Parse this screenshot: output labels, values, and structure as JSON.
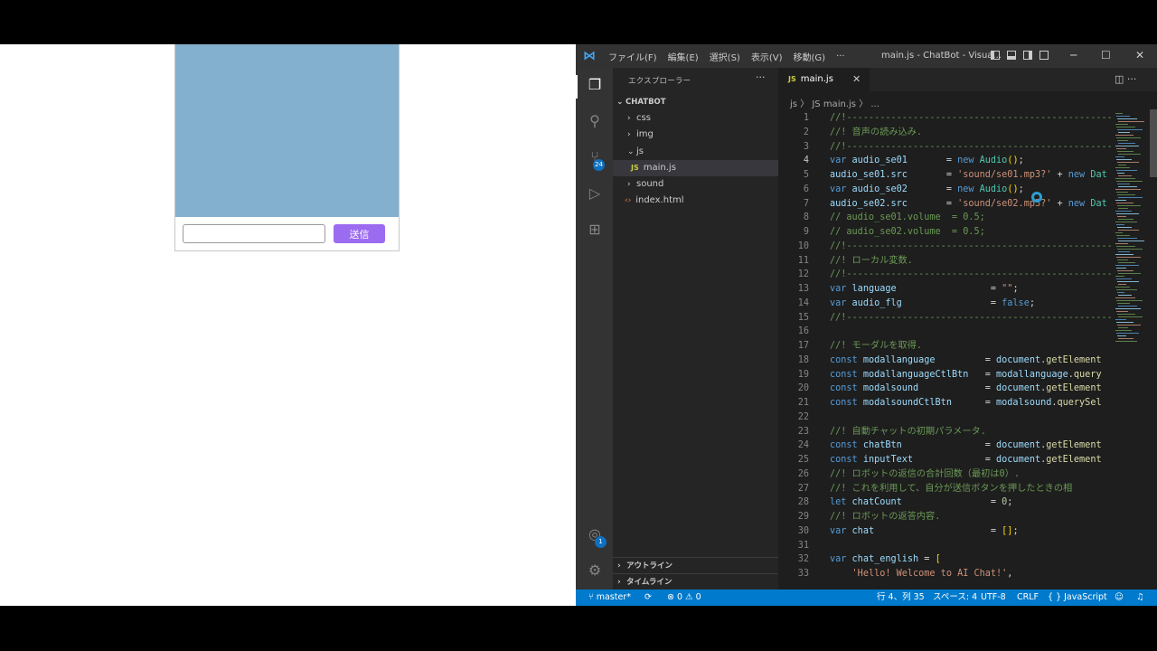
{
  "preview": {
    "chat_input_value": "",
    "send_label": "送信",
    "accent": "#9b6bf0",
    "chat_bg": "#84b0cf"
  },
  "titlebar": {
    "menus": [
      "ファイル(F)",
      "編集(E)",
      "選択(S)",
      "表示(V)",
      "移動(G)",
      "···"
    ],
    "title": "main.js - ChatBot - Visua..."
  },
  "activity": {
    "scm_badge": "24",
    "accounts_badge": "1"
  },
  "sidebar": {
    "title": "エクスプローラー",
    "more": "···",
    "root": "CHATBOT",
    "items": [
      {
        "label": "css",
        "type": "folder",
        "expanded": false
      },
      {
        "label": "img",
        "type": "folder",
        "expanded": false
      },
      {
        "label": "js",
        "type": "folder",
        "expanded": true
      },
      {
        "label": "main.js",
        "type": "js",
        "selected": true
      },
      {
        "label": "sound",
        "type": "folder",
        "expanded": false
      },
      {
        "label": "index.html",
        "type": "html"
      }
    ],
    "outline": "アウトライン",
    "timeline": "タイムライン"
  },
  "editor": {
    "tab_label": "main.js",
    "breadcrumb": "js 〉 JS main.js 〉 ...",
    "lines": [
      {
        "n": "1",
        "t": [
          [
            "com",
            "//!-----------------------------------------------------------"
          ]
        ]
      },
      {
        "n": "2",
        "t": [
          [
            "com",
            "//! 音声の読み込み."
          ]
        ]
      },
      {
        "n": "3",
        "t": [
          [
            "com",
            "//!-----------------------------------------------------------"
          ]
        ]
      },
      {
        "n": "4",
        "t": [
          [
            "kw",
            "var "
          ],
          [
            "var",
            "audio_se01"
          ],
          [
            "pun",
            "       = "
          ],
          [
            "kw",
            "new "
          ],
          [
            "cls",
            "Audio"
          ],
          [
            "br",
            "()"
          ],
          [
            "pun",
            ";"
          ]
        ]
      },
      {
        "n": "5",
        "t": [
          [
            "var",
            "audio_se01"
          ],
          [
            "pun",
            "."
          ],
          [
            "var",
            "src"
          ],
          [
            "pun",
            "       = "
          ],
          [
            "str",
            "'sound/se01.mp3?'"
          ],
          [
            "pun",
            " + "
          ],
          [
            "kw",
            "new "
          ],
          [
            "cls",
            "Dat"
          ]
        ]
      },
      {
        "n": "6",
        "t": [
          [
            "kw",
            "var "
          ],
          [
            "var",
            "audio_se02"
          ],
          [
            "pun",
            "       = "
          ],
          [
            "kw",
            "new "
          ],
          [
            "cls",
            "Audio"
          ],
          [
            "br",
            "()"
          ],
          [
            "pun",
            ";"
          ]
        ]
      },
      {
        "n": "7",
        "t": [
          [
            "var",
            "audio_se02"
          ],
          [
            "pun",
            "."
          ],
          [
            "var",
            "src"
          ],
          [
            "pun",
            "       = "
          ],
          [
            "str",
            "'sound/se02.mp3?'"
          ],
          [
            "pun",
            " + "
          ],
          [
            "kw",
            "new "
          ],
          [
            "cls",
            "Dat"
          ]
        ]
      },
      {
        "n": "8",
        "t": [
          [
            "com",
            "// audio_se01.volume  = 0.5;"
          ]
        ]
      },
      {
        "n": "9",
        "t": [
          [
            "com",
            "// audio_se02.volume  = 0.5;"
          ]
        ]
      },
      {
        "n": "10",
        "t": [
          [
            "com",
            "//!-----------------------------------------------------------"
          ]
        ]
      },
      {
        "n": "11",
        "t": [
          [
            "com",
            "//! ローカル変数."
          ]
        ]
      },
      {
        "n": "12",
        "t": [
          [
            "com",
            "//!-----------------------------------------------------------"
          ]
        ]
      },
      {
        "n": "13",
        "t": [
          [
            "kw",
            "var "
          ],
          [
            "var",
            "language"
          ],
          [
            "pun",
            "                 = "
          ],
          [
            "str",
            "\"\""
          ],
          [
            "pun",
            ";"
          ]
        ]
      },
      {
        "n": "14",
        "t": [
          [
            "kw",
            "var "
          ],
          [
            "var",
            "audio_flg"
          ],
          [
            "pun",
            "                = "
          ],
          [
            "kw",
            "false"
          ],
          [
            "pun",
            ";"
          ]
        ]
      },
      {
        "n": "15",
        "t": [
          [
            "com",
            "//!-----------------------------------------------------------"
          ]
        ]
      },
      {
        "n": "16",
        "t": []
      },
      {
        "n": "17",
        "t": [
          [
            "com",
            "//! モーダルを取得."
          ]
        ]
      },
      {
        "n": "18",
        "t": [
          [
            "kw",
            "const "
          ],
          [
            "var",
            "modallanguage"
          ],
          [
            "pun",
            "         = "
          ],
          [
            "var",
            "document"
          ],
          [
            "pun",
            "."
          ],
          [
            "fn",
            "getElement"
          ]
        ]
      },
      {
        "n": "19",
        "t": [
          [
            "kw",
            "const "
          ],
          [
            "var",
            "modallanguageCtlBtn"
          ],
          [
            "pun",
            "   = "
          ],
          [
            "var",
            "modallanguage"
          ],
          [
            "pun",
            "."
          ],
          [
            "fn",
            "query"
          ]
        ]
      },
      {
        "n": "20",
        "t": [
          [
            "kw",
            "const "
          ],
          [
            "var",
            "modalsound"
          ],
          [
            "pun",
            "            = "
          ],
          [
            "var",
            "document"
          ],
          [
            "pun",
            "."
          ],
          [
            "fn",
            "getElement"
          ]
        ]
      },
      {
        "n": "21",
        "t": [
          [
            "kw",
            "const "
          ],
          [
            "var",
            "modalsoundCtlBtn"
          ],
          [
            "pun",
            "      = "
          ],
          [
            "var",
            "modalsound"
          ],
          [
            "pun",
            "."
          ],
          [
            "fn",
            "querySel"
          ]
        ]
      },
      {
        "n": "22",
        "t": []
      },
      {
        "n": "23",
        "t": [
          [
            "com",
            "//! 自動チャットの初期パラメータ."
          ]
        ]
      },
      {
        "n": "24",
        "t": [
          [
            "kw",
            "const "
          ],
          [
            "var",
            "chatBtn"
          ],
          [
            "pun",
            "               = "
          ],
          [
            "var",
            "document"
          ],
          [
            "pun",
            "."
          ],
          [
            "fn",
            "getElement"
          ]
        ]
      },
      {
        "n": "25",
        "t": [
          [
            "kw",
            "const "
          ],
          [
            "var",
            "inputText"
          ],
          [
            "pun",
            "             = "
          ],
          [
            "var",
            "document"
          ],
          [
            "pun",
            "."
          ],
          [
            "fn",
            "getElement"
          ]
        ]
      },
      {
        "n": "26",
        "t": [
          [
            "com",
            "//! ロボットの返信の合計回数（最初は0）."
          ]
        ]
      },
      {
        "n": "27",
        "t": [
          [
            "com",
            "//! これを利用して、自分が送信ボタンを押したときの相"
          ]
        ]
      },
      {
        "n": "28",
        "t": [
          [
            "kw",
            "let "
          ],
          [
            "var",
            "chatCount"
          ],
          [
            "pun",
            "                = "
          ],
          [
            "num",
            "0"
          ],
          [
            "pun",
            ";"
          ]
        ]
      },
      {
        "n": "29",
        "t": [
          [
            "com",
            "//! ロボットの返答内容."
          ]
        ]
      },
      {
        "n": "30",
        "t": [
          [
            "kw",
            "var "
          ],
          [
            "var",
            "chat"
          ],
          [
            "pun",
            "                     = "
          ],
          [
            "br",
            "[]"
          ],
          [
            "pun",
            ";"
          ]
        ]
      },
      {
        "n": "31",
        "t": []
      },
      {
        "n": "32",
        "t": [
          [
            "kw",
            "var "
          ],
          [
            "var",
            "chat_english"
          ],
          [
            "pun",
            " = "
          ],
          [
            "br",
            "["
          ]
        ]
      },
      {
        "n": "33",
        "t": [
          [
            "pun",
            "    "
          ],
          [
            "str",
            "'Hello! Welcome to AI Chat!'"
          ],
          [
            "pun",
            ","
          ]
        ]
      }
    ]
  },
  "statusbar": {
    "branch": "master*",
    "sync": "⟳",
    "problems": "⊗ 0 ⚠ 0",
    "position": "行 4、列 35",
    "spaces": "スペース: 4",
    "encoding": "UTF-8",
    "eol": "CRLF",
    "language": "{ } JavaScript"
  }
}
